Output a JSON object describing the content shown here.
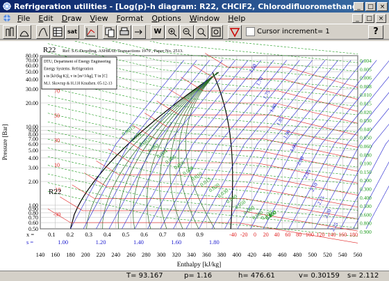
{
  "window": {
    "title": "Refrigeration utilities - [Log(p)-h diagram: R22, CHClF2, Chlorodifluoromethane]"
  },
  "menu": [
    "File",
    "Edit",
    "Draw",
    "View",
    "Format",
    "Options",
    "Window",
    "Help"
  ],
  "toolbar": {
    "cursor_label": "Cursor increment= 1",
    "sat_label": "sat",
    "w_label": "W",
    "help_label": "?"
  },
  "chart": {
    "refrigerant": "R22",
    "reference": "Ref: S.G.Dowding. ASHRAE Transactions 1979 , Paper No. 2513.",
    "info_box": [
      "DTU, Department of Energy Engineering",
      "Energy Systems. Refrigeration",
      "s in [kJ/(kg K)], v in [m^3/kg], T in [C]",
      "M.J. Skovrup & H.J.H Knudsen. 05-12-13"
    ],
    "y_label": "Pressure [Bar]",
    "x_label": "Enthalpy [kJ/kg]",
    "y_ticks": [
      "80.00",
      "70.00",
      "60.00",
      "50.00",
      "40.00",
      "30.00",
      "20.00",
      "10.00",
      "9.00",
      "8.00",
      "7.00",
      "6.00",
      "5.00",
      "4.00",
      "3.00",
      "2.00",
      "1.00",
      "0.90",
      "0.80",
      "0.70",
      "0.60",
      "0.50"
    ],
    "x_ticks": [
      "140",
      "160",
      "180",
      "200",
      "220",
      "240",
      "260",
      "280",
      "300",
      "320",
      "340",
      "360",
      "380",
      "400",
      "420",
      "440",
      "460",
      "480",
      "500",
      "520",
      "540",
      "560"
    ],
    "x_quality_label": "x =",
    "x_quality": [
      "0.1",
      "0.2",
      "0.3",
      "0.4",
      "0.5",
      "0.6",
      "0.7",
      "0.8",
      "0.9"
    ],
    "s_label": "s =",
    "s_values": [
      "1.00",
      "1.20",
      "1.40",
      "1.60",
      "1.80"
    ],
    "temps_right": [
      "-40",
      "-20",
      "0",
      "20",
      "40",
      "60",
      "80",
      "100",
      "120",
      "140",
      "160",
      "180"
    ],
    "temps_left": [
      "-30",
      "-10",
      "10",
      "30",
      "50",
      "70"
    ],
    "density_labels": [
      "0.0015",
      "0.002",
      "0.0025",
      "0.003",
      "0.004",
      "0.005",
      "0.006",
      "0.008",
      "0.010",
      "0.015",
      "0.020",
      "0.030",
      "0.040",
      "0.050",
      "0.060",
      "0.080",
      "0.100",
      "0.150",
      "0.200",
      "0.300",
      "0.400",
      "0.500",
      "0.600",
      "0.800"
    ],
    "v_right": [
      "0.004",
      "0.005",
      "0.006",
      "0.008",
      "0.010",
      "0.015",
      "0.020",
      "0.030",
      "0.040",
      "0.050",
      "0.060",
      "0.080",
      "0.100",
      "0.150",
      "0.200",
      "0.300",
      "0.400",
      "0.500",
      "0.600",
      "0.800",
      "0.900"
    ],
    "entropy_right": [
      "1.60",
      "1.70",
      "1.75",
      "1.80",
      "1.85",
      "1.90",
      "1.95",
      "2.00",
      "2.05",
      "2.10",
      "2.15",
      "2.20",
      "2.25"
    ]
  },
  "status": {
    "T": "T=  93.167",
    "p": "p=  1.16",
    "h": "h=  476.61",
    "v": "v=  0.30159",
    "s": "s=  2.112"
  },
  "colors": {
    "title_bar": "#0a246a",
    "grid": "#b4b4b4",
    "quality": "#2a6a2a",
    "isotherm": "#e02020",
    "isentrope": "#2020d0",
    "isochore": "#1a9a1a"
  }
}
